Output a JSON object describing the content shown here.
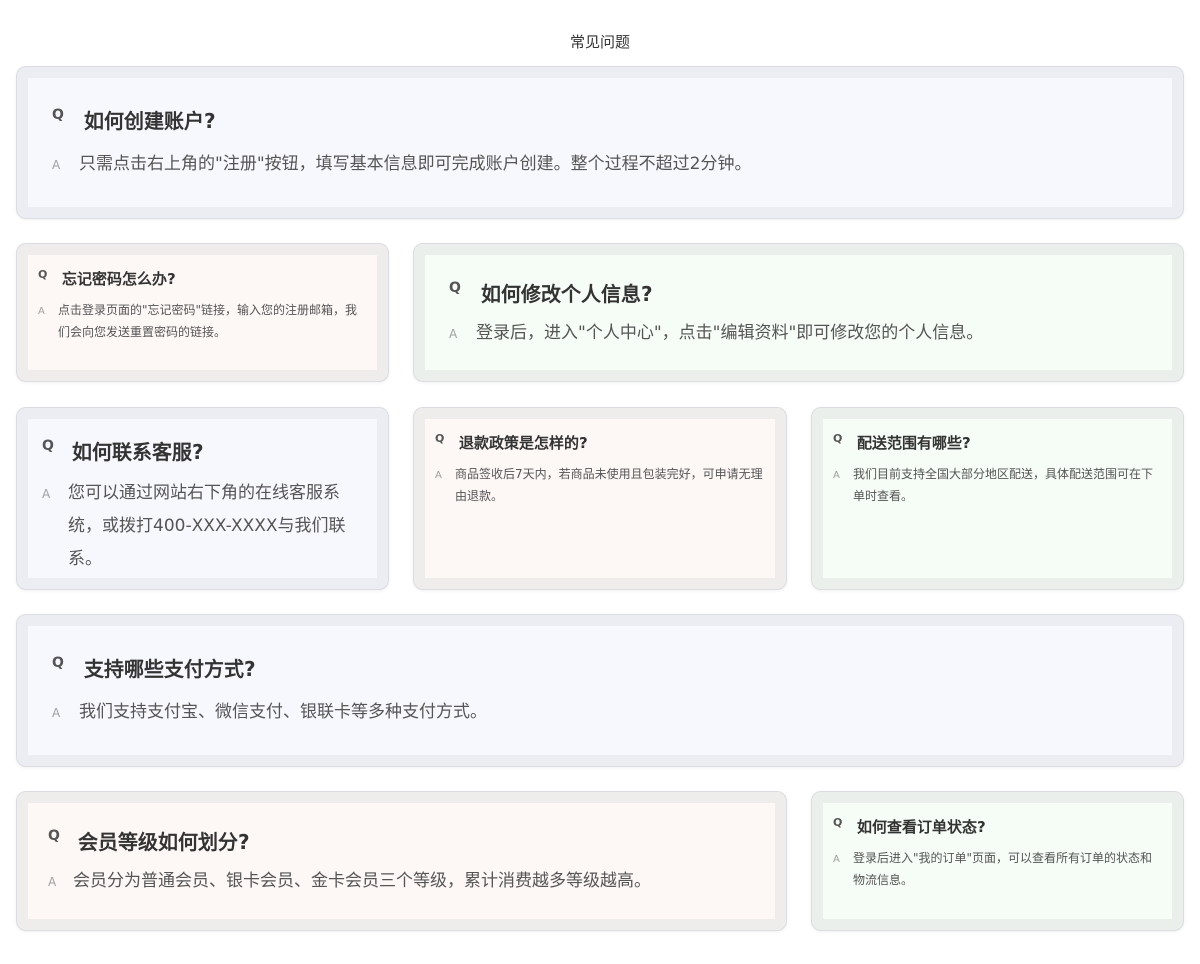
{
  "page": {
    "title": "常见问题"
  },
  "faq": [
    {
      "q_mark": "Q",
      "a_mark": "A",
      "question": "如何创建账户?",
      "answer": "只需点击右上角的\"注册\"按钮，填写基本信息即可完成账户创建。整个过程不超过2分钟。"
    },
    {
      "q_mark": "Q",
      "a_mark": "A",
      "question": "忘记密码怎么办?",
      "answer": "点击登录页面的\"忘记密码\"链接，输入您的注册邮箱，我们会向您发送重置密码的链接。"
    },
    {
      "q_mark": "Q",
      "a_mark": "A",
      "question": "如何修改个人信息?",
      "answer": "登录后，进入\"个人中心\"，点击\"编辑资料\"即可修改您的个人信息。"
    },
    {
      "q_mark": "Q",
      "a_mark": "A",
      "question": "如何联系客服?",
      "answer": "您可以通过网站右下角的在线客服系统，或拨打400-XXX-XXXX与我们联系。"
    },
    {
      "q_mark": "Q",
      "a_mark": "A",
      "question": "退款政策是怎样的?",
      "answer": "商品签收后7天内，若商品未使用且包装完好，可申请无理由退款。"
    },
    {
      "q_mark": "Q",
      "a_mark": "A",
      "question": "配送范围有哪些?",
      "answer": "我们目前支持全国大部分地区配送，具体配送范围可在下单时查看。"
    },
    {
      "q_mark": "Q",
      "a_mark": "A",
      "question": "支持哪些支付方式?",
      "answer": "我们支持支付宝、微信支付、银联卡等多种支付方式。"
    },
    {
      "q_mark": "Q",
      "a_mark": "A",
      "question": "会员等级如何划分?",
      "answer": "会员分为普通会员、银卡会员、金卡会员三个等级，累计消费越多等级越高。"
    },
    {
      "q_mark": "Q",
      "a_mark": "A",
      "question": "如何查看订单状态?",
      "answer": "登录后进入\"我的订单\"页面，可以查看所有订单的状态和物流信息。"
    }
  ]
}
